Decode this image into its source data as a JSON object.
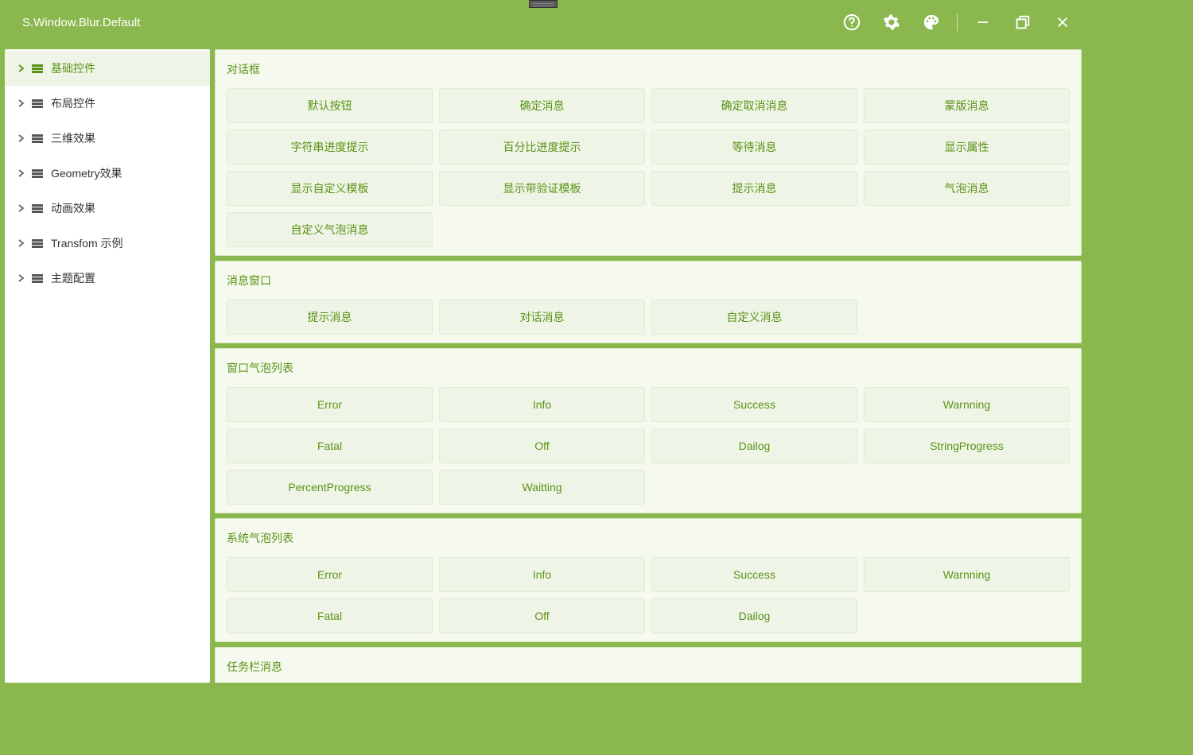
{
  "window": {
    "title": "S.Window.Blur.Default"
  },
  "sidebar": {
    "items": [
      {
        "label": "基础控件",
        "active": true
      },
      {
        "label": "布局控件",
        "active": false
      },
      {
        "label": "三维效果",
        "active": false
      },
      {
        "label": "Geometry效果",
        "active": false
      },
      {
        "label": "动画效果",
        "active": false
      },
      {
        "label": "Transfom 示例",
        "active": false
      },
      {
        "label": "主题配置",
        "active": false
      }
    ]
  },
  "sections": [
    {
      "title": "对话框",
      "buttons": [
        "默认按钮",
        "确定消息",
        "确定取消消息",
        "蒙版消息",
        "字符串进度提示",
        "百分比进度提示",
        "等待消息",
        "显示属性",
        "显示自定义模板",
        "显示带验证模板",
        "提示消息",
        "气泡消息",
        "自定义气泡消息"
      ]
    },
    {
      "title": "消息窗口",
      "buttons": [
        "提示消息",
        "对话消息",
        "自定义消息"
      ]
    },
    {
      "title": "窗口气泡列表",
      "buttons": [
        "Error",
        "Info",
        "Success",
        "Warnning",
        "Fatal",
        "Off",
        "Dailog",
        "StringProgress",
        "PercentProgress",
        "Waitting"
      ]
    },
    {
      "title": "系统气泡列表",
      "buttons": [
        "Error",
        "Info",
        "Success",
        "Warnning",
        "Fatal",
        "Off",
        "Dailog"
      ]
    },
    {
      "title": "任务栏消息",
      "buttons": []
    }
  ]
}
